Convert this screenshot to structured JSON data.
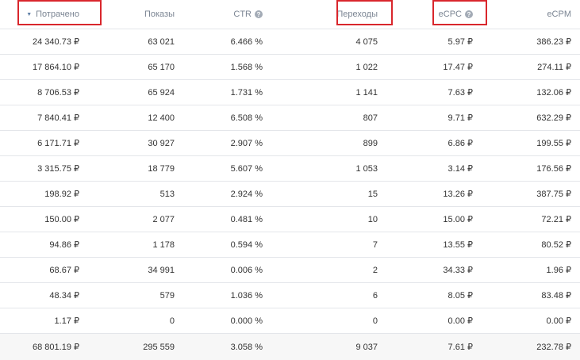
{
  "columns": {
    "spent": "Потрачено",
    "impressions": "Показы",
    "ctr": "CTR",
    "clicks": "Переходы",
    "ecpc": "eCPC",
    "ecpm": "eCPM"
  },
  "help_glyph": "?",
  "sort_glyph": "▼",
  "rows": [
    {
      "spent": "24 340.73 ₽",
      "impressions": "63 021",
      "ctr": "6.466 %",
      "clicks": "4 075",
      "ecpc": "5.97 ₽",
      "ecpm": "386.23 ₽"
    },
    {
      "spent": "17 864.10 ₽",
      "impressions": "65 170",
      "ctr": "1.568 %",
      "clicks": "1 022",
      "ecpc": "17.47 ₽",
      "ecpm": "274.11 ₽"
    },
    {
      "spent": "8 706.53 ₽",
      "impressions": "65 924",
      "ctr": "1.731 %",
      "clicks": "1 141",
      "ecpc": "7.63 ₽",
      "ecpm": "132.06 ₽"
    },
    {
      "spent": "7 840.41 ₽",
      "impressions": "12 400",
      "ctr": "6.508 %",
      "clicks": "807",
      "ecpc": "9.71 ₽",
      "ecpm": "632.29 ₽"
    },
    {
      "spent": "6 171.71 ₽",
      "impressions": "30 927",
      "ctr": "2.907 %",
      "clicks": "899",
      "ecpc": "6.86 ₽",
      "ecpm": "199.55 ₽"
    },
    {
      "spent": "3 315.75 ₽",
      "impressions": "18 779",
      "ctr": "5.607 %",
      "clicks": "1 053",
      "ecpc": "3.14 ₽",
      "ecpm": "176.56 ₽"
    },
    {
      "spent": "198.92 ₽",
      "impressions": "513",
      "ctr": "2.924 %",
      "clicks": "15",
      "ecpc": "13.26 ₽",
      "ecpm": "387.75 ₽"
    },
    {
      "spent": "150.00 ₽",
      "impressions": "2 077",
      "ctr": "0.481 %",
      "clicks": "10",
      "ecpc": "15.00 ₽",
      "ecpm": "72.21 ₽"
    },
    {
      "spent": "94.86 ₽",
      "impressions": "1 178",
      "ctr": "0.594 %",
      "clicks": "7",
      "ecpc": "13.55 ₽",
      "ecpm": "80.52 ₽"
    },
    {
      "spent": "68.67 ₽",
      "impressions": "34 991",
      "ctr": "0.006 %",
      "clicks": "2",
      "ecpc": "34.33 ₽",
      "ecpm": "1.96 ₽"
    },
    {
      "spent": "48.34 ₽",
      "impressions": "579",
      "ctr": "1.036 %",
      "clicks": "6",
      "ecpc": "8.05 ₽",
      "ecpm": "83.48 ₽"
    },
    {
      "spent": "1.17 ₽",
      "impressions": "0",
      "ctr": "0.000 %",
      "clicks": "0",
      "ecpc": "0.00 ₽",
      "ecpm": "0.00 ₽"
    }
  ],
  "total": {
    "spent": "68 801.19 ₽",
    "impressions": "295 559",
    "ctr": "3.058 %",
    "clicks": "9 037",
    "ecpc": "7.61 ₽",
    "ecpm": "232.78 ₽"
  },
  "colors": {
    "highlight": "#d9262c",
    "header_text": "#7b8593",
    "border": "#e4e6ea"
  }
}
